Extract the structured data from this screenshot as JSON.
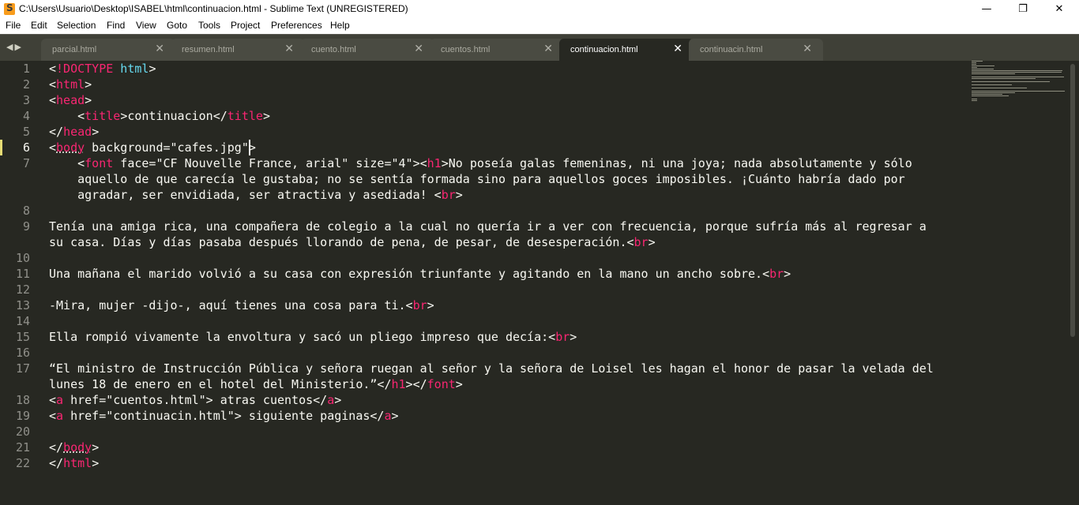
{
  "window": {
    "title": "C:\\Users\\Usuario\\Desktop\\ISABEL\\html\\continuacion.html - Sublime Text (UNREGISTERED)",
    "controls": {
      "minimize": "—",
      "maximize": "❐",
      "close": "✕"
    }
  },
  "menu": [
    "File",
    "Edit",
    "Selection",
    "Find",
    "View",
    "Goto",
    "Tools",
    "Project",
    "Preferences",
    "Help"
  ],
  "tabs": [
    {
      "label": "parcial.html",
      "active": false
    },
    {
      "label": "resumen.html",
      "active": false
    },
    {
      "label": "cuento.html",
      "active": false
    },
    {
      "label": "cuentos.html",
      "active": false
    },
    {
      "label": "continuacion.html",
      "active": true
    },
    {
      "label": "continuacin.html",
      "active": false
    }
  ],
  "tab_nav": "◀▶",
  "tab_close_glyph": "✕",
  "editor": {
    "current_line": 6,
    "line_numbers": [
      "1",
      "2",
      "3",
      "4",
      "5",
      "6",
      "7",
      "",
      "",
      "8",
      "9",
      "",
      "10",
      "11",
      "12",
      "13",
      "14",
      "15",
      "16",
      "17",
      "",
      "18",
      "19",
      "20",
      "21",
      "22"
    ],
    "lines": [
      "<!DOCTYPE html>",
      "<html>",
      "<head>",
      "    <title>continuacion</title>",
      "</head>",
      "<body background=\"cafes.jpg\">",
      "    <font face=\"CF Nouvelle France, arial\" size=\"4\"><h1>No poseía galas femeninas, ni una joya; nada absolutamente y sólo",
      "    aquello de que carecía le gustaba; no se sentía formada sino para aquellos goces imposibles. ¡Cuánto habría dado por",
      "    agradar, ser envidiada, ser atractiva y asediada! <br>",
      "",
      "Tenía una amiga rica, una compañera de colegio a la cual no quería ir a ver con frecuencia, porque sufría más al regresar a",
      "su casa. Días y días pasaba después llorando de pena, de pesar, de desesperación.<br>",
      "",
      "Una mañana el marido volvió a su casa con expresión triunfante y agitando en la mano un ancho sobre.<br>",
      "",
      "-Mira, mujer -dijo-, aquí tienes una cosa para ti.<br>",
      "",
      "Ella rompió vivamente la envoltura y sacó un pliego impreso que decía:<br>",
      "",
      "“El ministro de Instrucción Pública y señora ruegan al señor y la señora de Loisel les hagan el honor de pasar la velada del",
      "lunes 18 de enero en el hotel del Ministerio.”</h1></font>",
      "<a href=\"cuentos.html\"> atras cuentos</a>",
      "<a href=\"continuacin.html\"> siguiente paginas</a>",
      "",
      "</body>",
      "</html>"
    ]
  },
  "colors": {
    "background": "#272822",
    "tag": "#f92672",
    "attribute": "#a6e22e",
    "string": "#e6db74",
    "doctype": "#66d9ef",
    "text": "#f8f8f2"
  }
}
